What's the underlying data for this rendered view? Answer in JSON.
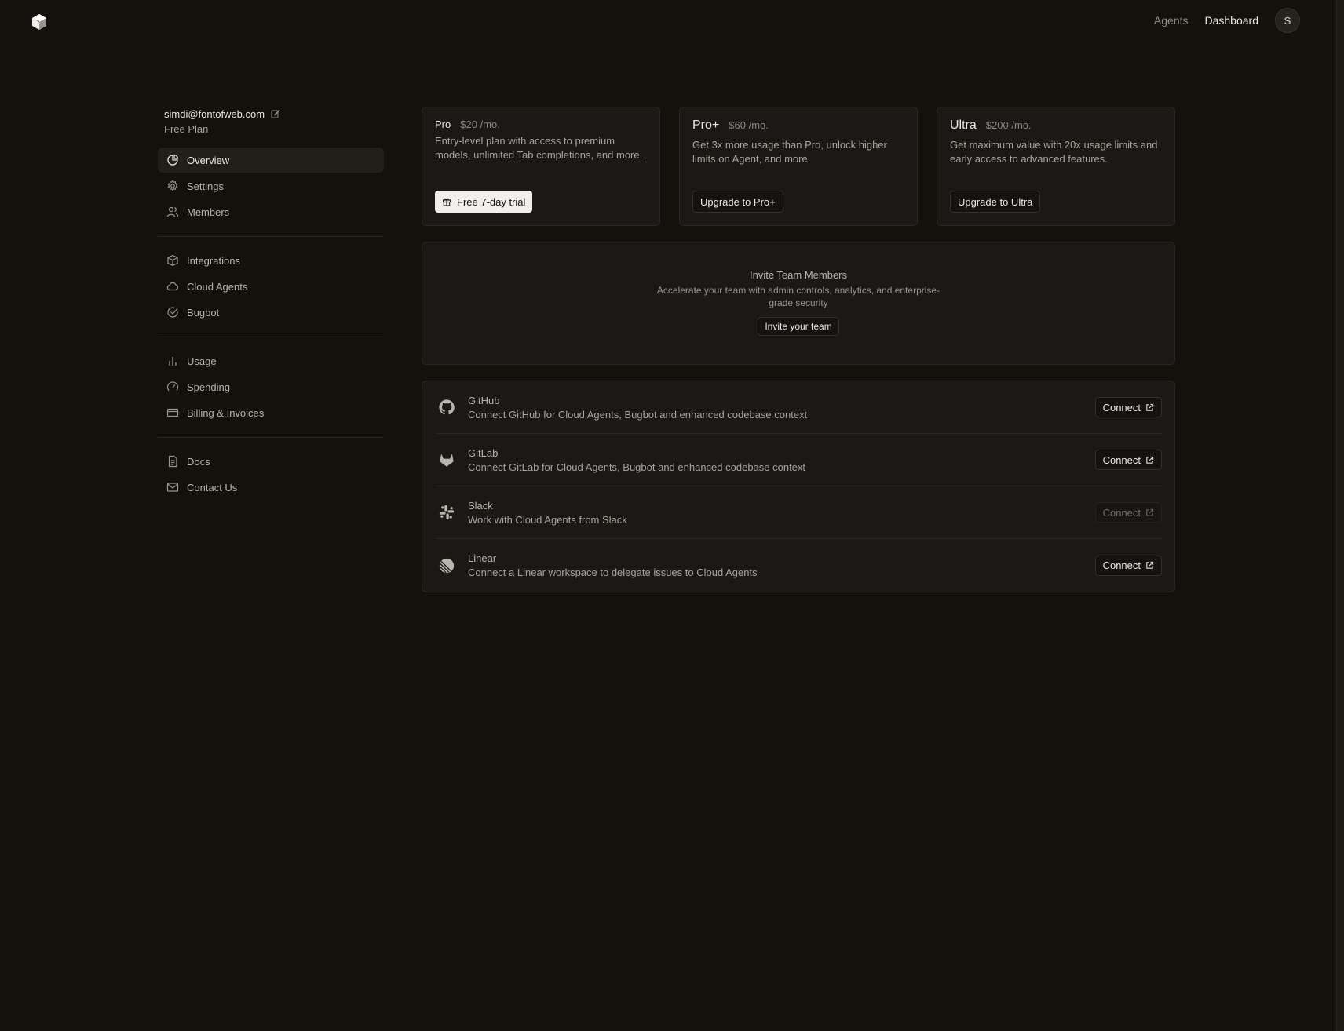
{
  "topbar": {
    "logo_icon": "cube-logo-icon",
    "nav": {
      "agents": "Agents",
      "dashboard": "Dashboard"
    },
    "avatar_initial": "S"
  },
  "account": {
    "email": "simdi@fontofweb.com",
    "plan": "Free Plan"
  },
  "sidebar": {
    "groups": [
      [
        {
          "label": "Overview",
          "icon": "pie-chart-icon",
          "active": true
        },
        {
          "label": "Settings",
          "icon": "gear-icon"
        },
        {
          "label": "Members",
          "icon": "users-icon"
        }
      ],
      [
        {
          "label": "Integrations",
          "icon": "package-icon"
        },
        {
          "label": "Cloud Agents",
          "icon": "cloud-icon"
        },
        {
          "label": "Bugbot",
          "icon": "check-circle-icon"
        }
      ],
      [
        {
          "label": "Usage",
          "icon": "bar-chart-icon"
        },
        {
          "label": "Spending",
          "icon": "gauge-icon"
        },
        {
          "label": "Billing & Invoices",
          "icon": "credit-card-icon"
        }
      ],
      [
        {
          "label": "Docs",
          "icon": "document-icon"
        },
        {
          "label": "Contact Us",
          "icon": "mail-icon"
        }
      ]
    ]
  },
  "plans": [
    {
      "name": "Pro",
      "price": "$20",
      "period": "/mo.",
      "description": "Entry-level plan with access to premium models, unlimited Tab completions, and more.",
      "button": "Free 7-day trial"
    },
    {
      "name": "Pro+",
      "price": "$60",
      "period": "/mo.",
      "description": "Get 3x more usage than Pro, unlock higher limits on Agent, and more.",
      "button": "Upgrade to Pro+"
    },
    {
      "name": "Ultra",
      "price": "$200",
      "period": "/mo.",
      "description": "Get maximum value with 20x usage limits and early access to advanced features.",
      "button": "Upgrade to Ultra"
    }
  ],
  "invite": {
    "title": "Invite Team Members",
    "description": "Accelerate your team with admin controls, analytics, and enterprise-grade security",
    "button": "Invite your team"
  },
  "integrations": [
    {
      "name": "GitHub",
      "description": "Connect GitHub for Cloud Agents, Bugbot and enhanced codebase context",
      "button": "Connect",
      "icon": "github-icon",
      "enabled": true
    },
    {
      "name": "GitLab",
      "description": "Connect GitLab for Cloud Agents, Bugbot and enhanced codebase context",
      "button": "Connect",
      "icon": "gitlab-icon",
      "enabled": true
    },
    {
      "name": "Slack",
      "description": "Work with Cloud Agents from Slack",
      "button": "Connect",
      "icon": "slack-icon",
      "enabled": false
    },
    {
      "name": "Linear",
      "description": "Connect a Linear workspace to delegate issues to Cloud Agents",
      "button": "Connect",
      "icon": "linear-icon",
      "enabled": true
    }
  ]
}
